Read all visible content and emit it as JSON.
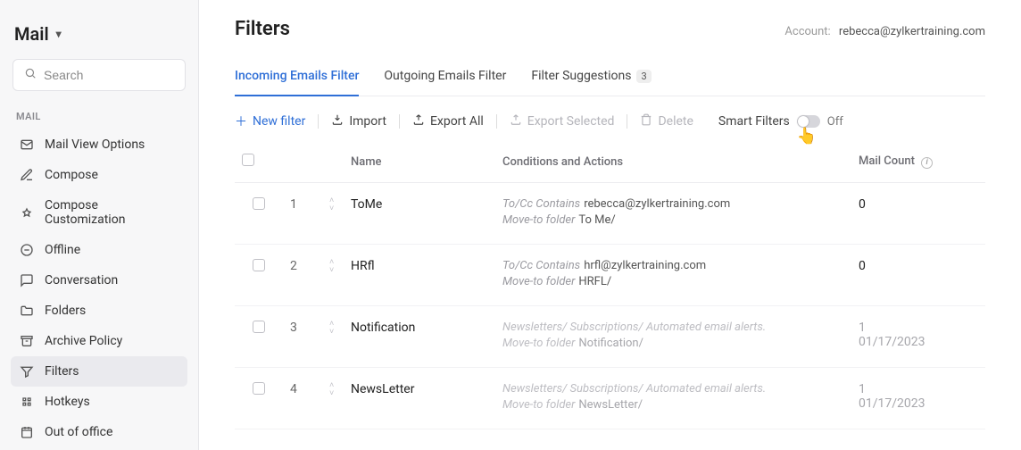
{
  "sidebar": {
    "app_title": "Mail",
    "search_placeholder": "Search",
    "section_label": "MAIL",
    "items": [
      {
        "label": "Mail View Options",
        "icon": "mail-options"
      },
      {
        "label": "Compose",
        "icon": "compose"
      },
      {
        "label": "Compose Customization",
        "icon": "customize"
      },
      {
        "label": "Offline",
        "icon": "offline"
      },
      {
        "label": "Conversation",
        "icon": "conversation"
      },
      {
        "label": "Folders",
        "icon": "folder"
      },
      {
        "label": "Archive Policy",
        "icon": "archive"
      },
      {
        "label": "Filters",
        "icon": "filter",
        "active": true
      },
      {
        "label": "Hotkeys",
        "icon": "hotkeys"
      },
      {
        "label": "Out of office",
        "icon": "out-of-office"
      }
    ]
  },
  "header": {
    "title": "Filters",
    "account_label": "Account:",
    "account_value": "rebecca@zylkertraining.com"
  },
  "tabs": [
    {
      "label": "Incoming Emails Filter",
      "active": true
    },
    {
      "label": "Outgoing Emails Filter"
    },
    {
      "label": "Filter Suggestions",
      "badge": "3"
    }
  ],
  "toolbar": {
    "new_filter": "New filter",
    "import": "Import",
    "export_all": "Export All",
    "export_selected": "Export Selected",
    "delete": "Delete",
    "smart_filters": "Smart Filters",
    "toggle_label": "Off"
  },
  "table": {
    "headers": {
      "name": "Name",
      "conditions": "Conditions and Actions",
      "count": "Mail Count"
    },
    "rows": [
      {
        "order": "1",
        "name": "ToMe",
        "cond1_label": "To/Cc Contains",
        "cond1_value": "rebecca@zylkertraining.com",
        "cond2_label": "Move-to folder",
        "cond2_value": "To Me/",
        "count": "0",
        "date": "",
        "dim": false
      },
      {
        "order": "2",
        "name": "HRfl",
        "cond1_label": "To/Cc Contains",
        "cond1_value": "hrfl@zylkertraining.com",
        "cond2_label": "Move-to folder",
        "cond2_value": "HRFL/",
        "count": "0",
        "date": "",
        "dim": false
      },
      {
        "order": "3",
        "name": "Notification",
        "cond1_label": "",
        "cond1_value": "Newsletters/ Subscriptions/ Automated email alerts.",
        "cond2_label": "Move-to folder",
        "cond2_value": "Notification/",
        "count": "1",
        "date": "01/17/2023",
        "dim": true
      },
      {
        "order": "4",
        "name": "NewsLetter",
        "cond1_label": "",
        "cond1_value": "Newsletters/ Subscriptions/ Automated email alerts.",
        "cond2_label": "Move-to folder",
        "cond2_value": "NewsLetter/",
        "count": "1",
        "date": "01/17/2023",
        "dim": true
      }
    ]
  }
}
